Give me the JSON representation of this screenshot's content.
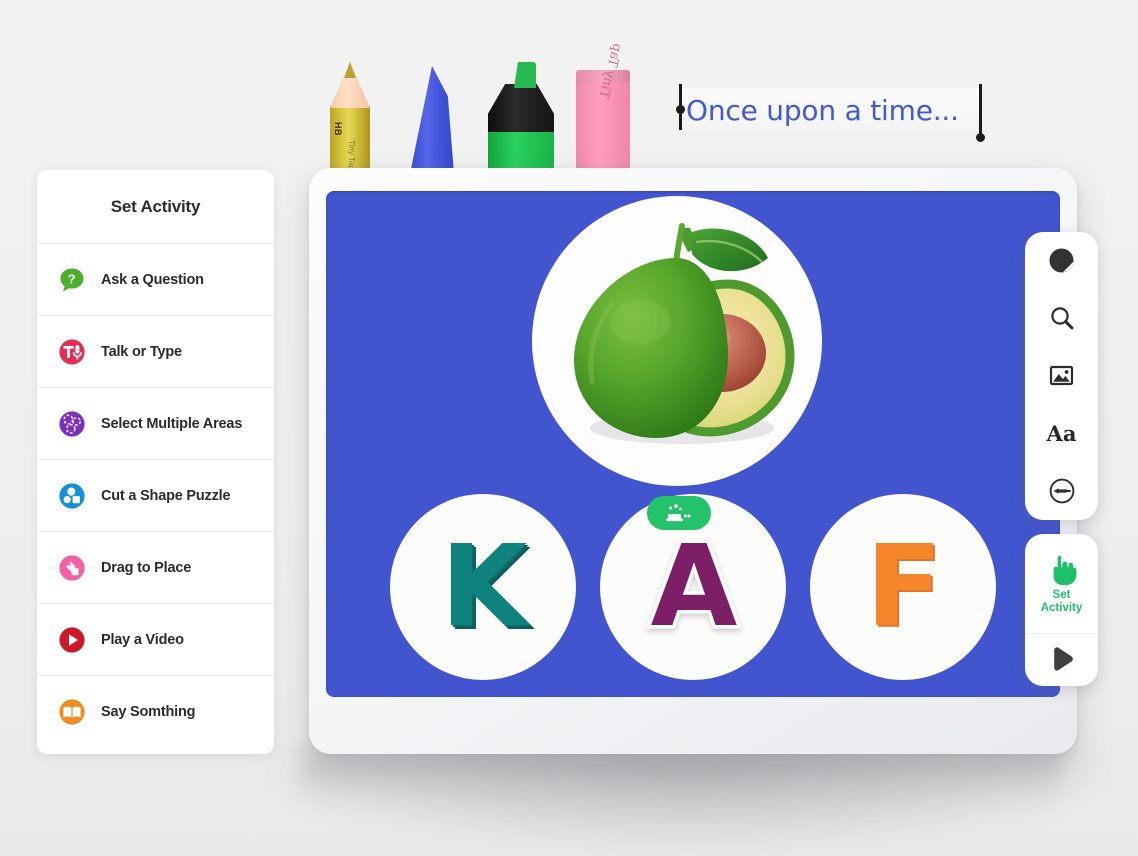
{
  "colors": {
    "canvas_blue": "#4254ce",
    "story_text": "#4159d8",
    "set_activity_green": "#1fc06a",
    "page_background": "#efefef"
  },
  "desk_tools": [
    {
      "name": "pencil",
      "grade_label": "HB",
      "brand_label": "Tiny Tap",
      "color": "#d9c83f"
    },
    {
      "name": "crayon",
      "color": "#4656dd"
    },
    {
      "name": "highlighter",
      "color": "#1fb94b"
    },
    {
      "name": "eraser",
      "brand_label": "Tiny Tap",
      "color": "#ff9ebd"
    }
  ],
  "story_field": {
    "value": "Once upon a time...",
    "placeholder": "Once upon a time..."
  },
  "sidebar": {
    "title": "Set Activity",
    "items": [
      {
        "label": "Ask a Question",
        "icon": "question-bubble-icon",
        "color": "#4cae2a"
      },
      {
        "label": "Talk or Type",
        "icon": "text-microphone-icon",
        "color": "#e22f56"
      },
      {
        "label": "Select Multiple Areas",
        "icon": "multi-select-icon",
        "color": "#7d2fbf"
      },
      {
        "label": "Cut a Shape Puzzle",
        "icon": "shapes-puzzle-icon",
        "color": "#1391d4"
      },
      {
        "label": "Drag to Place",
        "icon": "drag-shapes-icon",
        "color": "#f45fa4"
      },
      {
        "label": "Play a Video",
        "icon": "play-video-icon",
        "color": "#cc1828"
      },
      {
        "label": "Say Somthing",
        "icon": "open-book-icon",
        "color": "#ef8c20"
      }
    ]
  },
  "canvas": {
    "media": {
      "name": "avocado-photo",
      "alt": "Whole avocado and halved avocado with pit"
    },
    "letters": [
      {
        "letter": "K",
        "color": "#10827d",
        "badge": null
      },
      {
        "letter": "A",
        "color": "#7c1f66",
        "badge": "magic-hat-badge"
      },
      {
        "letter": "F",
        "color": "#f5862c",
        "badge": null
      }
    ]
  },
  "toolbar": {
    "items": [
      {
        "name": "sticker-icon"
      },
      {
        "name": "search-icon"
      },
      {
        "name": "image-icon"
      },
      {
        "name": "text-icon",
        "label": "Aa"
      },
      {
        "name": "pen-icon"
      }
    ]
  },
  "action_panel": {
    "set_activity_label_line1": "Set",
    "set_activity_label_line2": "Activity",
    "hand_icon": "pointing-hand-icon",
    "play_icon": "play-icon"
  }
}
